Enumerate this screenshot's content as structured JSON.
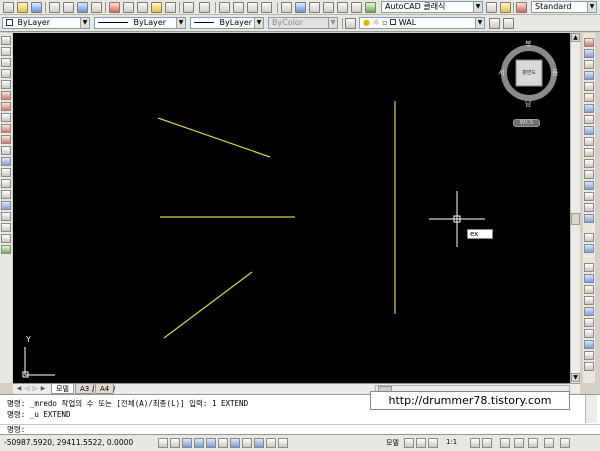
{
  "toolbar": {
    "workspace": "AutoCAD 클래식",
    "text_style": "Standard"
  },
  "properties": {
    "color": "ByLayer",
    "linetype": "ByLayer",
    "lineweight": "ByLayer",
    "plotstyle": "ByColor",
    "layer": "WAL"
  },
  "viewcube": {
    "north": "북",
    "south": "남",
    "east": "동",
    "west": "서",
    "face": "평면도",
    "wcs": "WCS"
  },
  "canvas": {
    "cursor_input": "ex",
    "ucs_y": "Y"
  },
  "tabs": [
    "모델",
    "A3",
    "A4"
  ],
  "tab_separators": [
    "/",
    "/"
  ],
  "command": {
    "history": [
      "명령: _mredo 작업의 수 또는 [전체(A)/최종(L)] 입력: 1 EXTEND",
      "명령: _u EXTEND"
    ],
    "prompt": "명령:"
  },
  "watermark": "http://drummer78.tistory.com",
  "status": {
    "coordinates": "-50987.5920, 29411.5522, 0.0000",
    "model": "모델",
    "annotation_scale": "1:1"
  },
  "colors": {
    "canvas": "#000000",
    "line": "#d8d043",
    "crosshair": "#ffffff"
  }
}
